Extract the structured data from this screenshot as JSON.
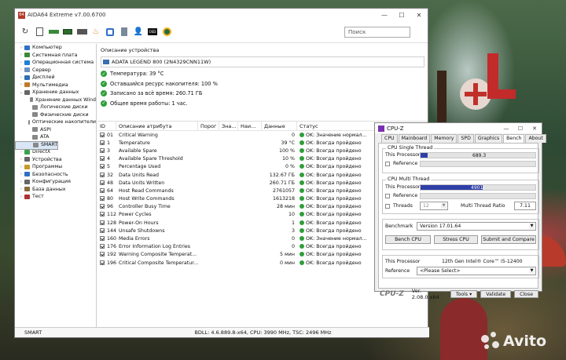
{
  "aida": {
    "app_icon": "64",
    "title": "AIDA64 Extreme v7.00.6700",
    "search_placeholder": "Поиск",
    "tree": [
      {
        "label": "Компьютер",
        "level": 1,
        "color": "#2f6fc7"
      },
      {
        "label": "Системная плата",
        "level": 1,
        "color": "#3a8a3a"
      },
      {
        "label": "Операционная система",
        "level": 1,
        "color": "#1f7ed6"
      },
      {
        "label": "Сервер",
        "level": 1,
        "color": "#6b8fc1"
      },
      {
        "label": "Дисплей",
        "level": 1,
        "color": "#2d6fb0"
      },
      {
        "label": "Мультимедиа",
        "level": 1,
        "color": "#c07a2a"
      },
      {
        "label": "Хранение данных",
        "level": 1,
        "color": "#666666"
      },
      {
        "label": "Хранение данных Wind",
        "level": 2,
        "color": "#888888"
      },
      {
        "label": "Логические диски",
        "level": 2,
        "color": "#888888"
      },
      {
        "label": "Физические диски",
        "level": 2,
        "color": "#888888"
      },
      {
        "label": "Оптические накопители",
        "level": 2,
        "color": "#888888"
      },
      {
        "label": "ASPI",
        "level": 2,
        "color": "#888888"
      },
      {
        "label": "ATA",
        "level": 2,
        "color": "#888888"
      },
      {
        "label": "SMART",
        "level": 2,
        "color": "#888888",
        "selected": true
      },
      {
        "label": "Сеть",
        "level": 1,
        "color": "#2f6fc7"
      },
      {
        "label": "DirectX",
        "level": 1,
        "color": "#3aa04a"
      },
      {
        "label": "Устройства",
        "level": 1,
        "color": "#666666"
      },
      {
        "label": "Программы",
        "level": 1,
        "color": "#c79a2a"
      },
      {
        "label": "Безопасность",
        "level": 1,
        "color": "#2f6fc7"
      },
      {
        "label": "Конфигурация",
        "level": 1,
        "color": "#666666"
      },
      {
        "label": "База данных",
        "level": 1,
        "color": "#8a6a3a"
      },
      {
        "label": "Тест",
        "level": 1,
        "color": "#b03030"
      }
    ],
    "device_header": "Описание устройства",
    "device_name": "ADATA LEGEND 800 (2N4329CNN11W)",
    "info": [
      "Температура: 39 °C",
      "Оставшийся ресурс накопителя: 100 %",
      "Записано за всё время: 260.71 ГБ",
      "Общее время работы: 1 час."
    ],
    "columns": [
      "ID",
      "Описание атрибута",
      "Порог",
      "Зна...",
      "Наи...",
      "Данные",
      "Статус"
    ],
    "rows": [
      {
        "id": "01",
        "name": "Critical Warning",
        "data": "0",
        "status": "OK: Значение нормал..."
      },
      {
        "id": "1",
        "name": "Temperature",
        "data": "39 °C",
        "status": "OK: Всегда пройдено"
      },
      {
        "id": "3",
        "name": "Available Spare",
        "data": "100 %",
        "status": "OK: Всегда пройдено"
      },
      {
        "id": "4",
        "name": "Available Spare Threshold",
        "data": "10 %",
        "status": "OK: Всегда пройдено"
      },
      {
        "id": "5",
        "name": "Percentage Used",
        "data": "0 %",
        "status": "OK: Всегда пройдено"
      },
      {
        "id": "32",
        "name": "Data Units Read",
        "data": "132.67 ГБ",
        "status": "OK: Всегда пройдено"
      },
      {
        "id": "48",
        "name": "Data Units Written",
        "data": "260.71 ГБ",
        "status": "OK: Всегда пройдено"
      },
      {
        "id": "64",
        "name": "Host Read Commands",
        "data": "2761057",
        "status": "OK: Всегда пройдено"
      },
      {
        "id": "80",
        "name": "Host Write Commands",
        "data": "1613218",
        "status": "OK: Всегда пройдено"
      },
      {
        "id": "96",
        "name": "Controller Busy Time",
        "data": "28 мин",
        "status": "OK: Всегда пройдено"
      },
      {
        "id": "112",
        "name": "Power Cycles",
        "data": "10",
        "status": "OK: Всегда пройдено"
      },
      {
        "id": "128",
        "name": "Power-On Hours",
        "data": "1",
        "status": "OK: Всегда пройдено"
      },
      {
        "id": "144",
        "name": "Unsafe Shutdowns",
        "data": "3",
        "status": "OK: Всегда пройдено"
      },
      {
        "id": "160",
        "name": "Media Errors",
        "data": "0",
        "status": "OK: Значение нормал..."
      },
      {
        "id": "176",
        "name": "Error Information Log Entries",
        "data": "0",
        "status": "OK: Всегда пройдено"
      },
      {
        "id": "192",
        "name": "Warning Composite Temperat...",
        "data": "5 мин",
        "status": "OK: Всегда пройдено"
      },
      {
        "id": "196",
        "name": "Critical Composite Temperatur...",
        "data": "0 мин",
        "status": "OK: Всегда пройдено"
      }
    ],
    "statusbar_left": "SMART",
    "statusbar_right": "BDLL: 4.6.889.8-x64, CPU: 3990 MHz, TSC: 2496 MHz"
  },
  "cpuz": {
    "title": "CPU-Z",
    "tabs": [
      "CPU",
      "Mainboard",
      "Memory",
      "SPD",
      "Graphics",
      "Bench",
      "About"
    ],
    "active_tab": "Bench",
    "single_title": "CPU Single Thread",
    "this_processor": "This Processor",
    "reference": "Reference",
    "single_value": "689.3",
    "single_fill": 0.06,
    "multi_title": "CPU Multi Thread",
    "multi_value": "4901.",
    "multi_fill": 0.54,
    "threads_label": "Threads",
    "threads_value": "12",
    "mtr_label": "Multi Thread Ratio",
    "mtr_value": "7.11",
    "benchmark_label": "Benchmark",
    "benchmark_value": "Version 17.01.64",
    "bench_cpu": "Bench CPU",
    "stress_cpu": "Stress CPU",
    "submit": "Submit and Compare",
    "cpu_name": "12th Gen Intel® Core™ i5-12400",
    "ref_select": "<Please Select>",
    "brand": "CPU-Z",
    "version": "Ver. 2.08.0.x64",
    "tools": "Tools",
    "validate": "Validate",
    "close": "Close"
  },
  "watermark": "Avito"
}
